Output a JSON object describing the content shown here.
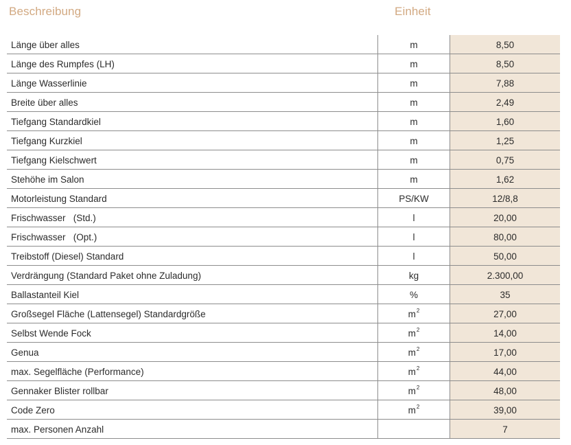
{
  "header": {
    "description": "Beschreibung",
    "unit": "Einheit"
  },
  "colors": {
    "header_text": "#d2a982",
    "value_column_bg": "#f1e6d8",
    "grid_line": "#8c8c8c"
  },
  "rows": [
    {
      "desc": "Länge über alles",
      "unit": "m",
      "unit_sup": "",
      "value": "8,50"
    },
    {
      "desc": "Länge des Rumpfes (LH)",
      "unit": "m",
      "unit_sup": "",
      "value": "8,50"
    },
    {
      "desc": "Länge Wasserlinie",
      "unit": "m",
      "unit_sup": "",
      "value": "7,88"
    },
    {
      "desc": "Breite über alles",
      "unit": "m",
      "unit_sup": "",
      "value": "2,49"
    },
    {
      "desc": "Tiefgang Standardkiel",
      "unit": "m",
      "unit_sup": "",
      "value": "1,60"
    },
    {
      "desc": "Tiefgang Kurzkiel",
      "unit": "m",
      "unit_sup": "",
      "value": "1,25"
    },
    {
      "desc": "Tiefgang Kielschwert",
      "unit": "m",
      "unit_sup": "",
      "value": "0,75"
    },
    {
      "desc": "Stehöhe im Salon",
      "unit": "m",
      "unit_sup": "",
      "value": "1,62"
    },
    {
      "desc": "Motorleistung Standard",
      "unit": "PS/KW",
      "unit_sup": "",
      "value": "12/8,8"
    },
    {
      "desc": "Frischwasser   (Std.)",
      "unit": "l",
      "unit_sup": "",
      "value": "20,00"
    },
    {
      "desc": "Frischwasser   (Opt.)",
      "unit": "l",
      "unit_sup": "",
      "value": "80,00"
    },
    {
      "desc": "Treibstoff (Diesel) Standard",
      "unit": "l",
      "unit_sup": "",
      "value": "50,00"
    },
    {
      "desc": "Verdrängung (Standard Paket ohne Zuladung)",
      "unit": "kg",
      "unit_sup": "",
      "value": "2.300,00"
    },
    {
      "desc": "Ballastanteil Kiel",
      "unit": "%",
      "unit_sup": "",
      "value": "35"
    },
    {
      "desc": "Großsegel Fläche (Lattensegel) Standardgröße",
      "unit": "m",
      "unit_sup": "2",
      "value": "27,00"
    },
    {
      "desc": "Selbst Wende Fock",
      "unit": "m",
      "unit_sup": "2",
      "value": "14,00"
    },
    {
      "desc": "Genua",
      "unit": "m",
      "unit_sup": "2",
      "value": "17,00"
    },
    {
      "desc": "max. Segelfläche (Performance)",
      "unit": "m",
      "unit_sup": "2",
      "value": "44,00"
    },
    {
      "desc": "Gennaker Blister rollbar",
      "unit": "m",
      "unit_sup": "2",
      "value": "48,00"
    },
    {
      "desc": "Code Zero",
      "unit": "m",
      "unit_sup": "2",
      "value": "39,00"
    },
    {
      "desc": "max. Personen Anzahl",
      "unit": "",
      "unit_sup": "",
      "value": "7"
    }
  ]
}
